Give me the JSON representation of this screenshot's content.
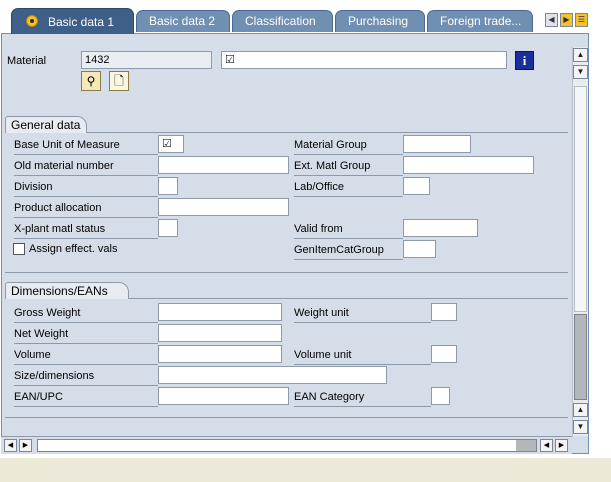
{
  "tabs": [
    {
      "label": "Basic data 1",
      "active": true
    },
    {
      "label": "Basic data 2",
      "active": false
    },
    {
      "label": "Classification",
      "active": false
    },
    {
      "label": "Purchasing",
      "active": false
    },
    {
      "label": "Foreign trade...",
      "active": false
    }
  ],
  "header": {
    "material_label": "Material",
    "material_value": "1432",
    "description_value": "☑"
  },
  "general": {
    "title": "General data",
    "base_uom_label": "Base Unit of Measure",
    "base_uom_value": "☑",
    "old_material_label": "Old material number",
    "division_label": "Division",
    "product_allocation_label": "Product allocation",
    "xplant_status_label": "X-plant matl status",
    "assign_effect_label": "Assign effect. vals",
    "material_group_label": "Material Group",
    "ext_matl_group_label": "Ext. Matl Group",
    "lab_office_label": "Lab/Office",
    "valid_from_label": "Valid from",
    "genitem_label": "GenItemCatGroup"
  },
  "dimensions": {
    "title": "Dimensions/EANs",
    "gross_weight_label": "Gross Weight",
    "net_weight_label": "Net Weight",
    "volume_label": "Volume",
    "size_label": "Size/dimensions",
    "ean_label": "EAN/UPC",
    "weight_unit_label": "Weight unit",
    "volume_unit_label": "Volume unit",
    "ean_category_label": "EAN Category"
  },
  "colors": {
    "tab_active": "#3e5f87",
    "tab_inactive": "#6f8fb3",
    "panel_bg": "#d5dee8",
    "info_icon": "#1a2f9b"
  },
  "icons": {
    "tab_status": "status-dot-icon",
    "info": "info-icon",
    "tool1": "glasses-icon",
    "tool2": "document-icon",
    "scroll_up": "arrow-up-icon",
    "scroll_down": "arrow-down-icon",
    "scroll_left": "arrow-left-icon",
    "scroll_right": "arrow-right-icon"
  }
}
